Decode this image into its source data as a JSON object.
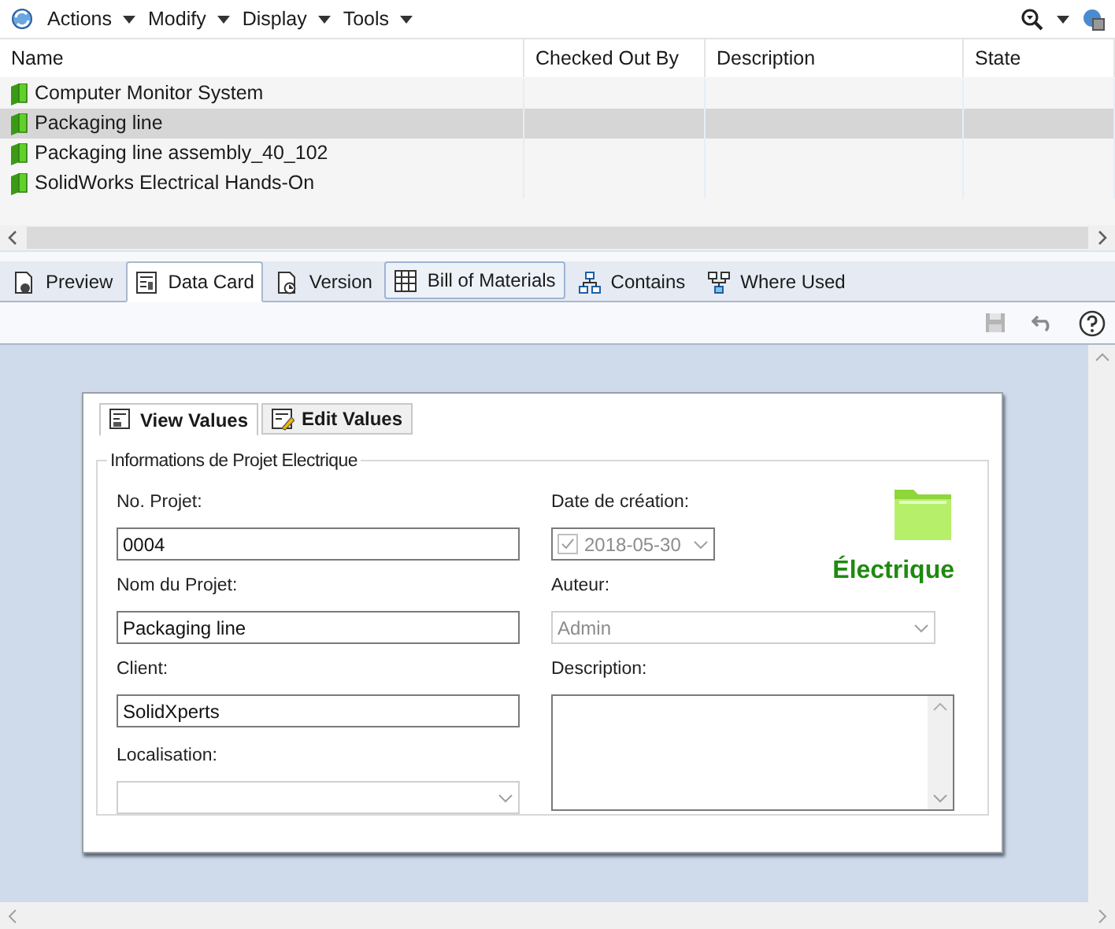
{
  "menu": [
    {
      "label": "Actions"
    },
    {
      "label": "Modify"
    },
    {
      "label": "Display"
    },
    {
      "label": "Tools"
    }
  ],
  "table": {
    "columns": [
      "Name",
      "Checked Out By",
      "Description",
      "State"
    ],
    "rows": [
      {
        "name": "Computer Monitor System",
        "selected": false
      },
      {
        "name": "Packaging line",
        "selected": true
      },
      {
        "name": "Packaging line assembly_40_102",
        "selected": false
      },
      {
        "name": "SolidWorks Electrical Hands-On",
        "selected": false
      }
    ]
  },
  "tabs": [
    {
      "label": "Preview",
      "kind": "preview",
      "selected": false,
      "highlighted": false
    },
    {
      "label": "Data Card",
      "kind": "card",
      "selected": true,
      "highlighted": false
    },
    {
      "label": "Version",
      "kind": "version",
      "selected": false,
      "highlighted": false
    },
    {
      "label": "Bill of Materials",
      "kind": "bom",
      "selected": false,
      "highlighted": true
    },
    {
      "label": "Contains",
      "kind": "contains",
      "selected": false,
      "highlighted": false
    },
    {
      "label": "Where Used",
      "kind": "whereused",
      "selected": false,
      "highlighted": false
    }
  ],
  "card": {
    "tabs": [
      {
        "label": "View Values",
        "selected": true
      },
      {
        "label": "Edit Values",
        "selected": false
      }
    ],
    "group_title": "Informations de Projet Electrique",
    "left_fields": [
      {
        "label": "No. Projet:",
        "kind": "text",
        "value": "0004",
        "disabled": false
      },
      {
        "label": "Nom du Projet:",
        "kind": "text",
        "value": "Packaging line",
        "disabled": false
      },
      {
        "label": "Client:",
        "kind": "text",
        "value": "SolidXperts",
        "disabled": false
      },
      {
        "label": "Localisation:",
        "kind": "combo",
        "disabled": true
      }
    ],
    "right_fields": [
      {
        "label": "Date de création:",
        "kind": "date",
        "value": "2018-05-30",
        "checked": true,
        "disabled": true
      },
      {
        "label": "Auteur:",
        "kind": "combo",
        "value": "Admin",
        "disabled": true
      },
      {
        "label": "Description:",
        "kind": "textarea",
        "disabled": false
      }
    ],
    "badge": "Électrique"
  }
}
